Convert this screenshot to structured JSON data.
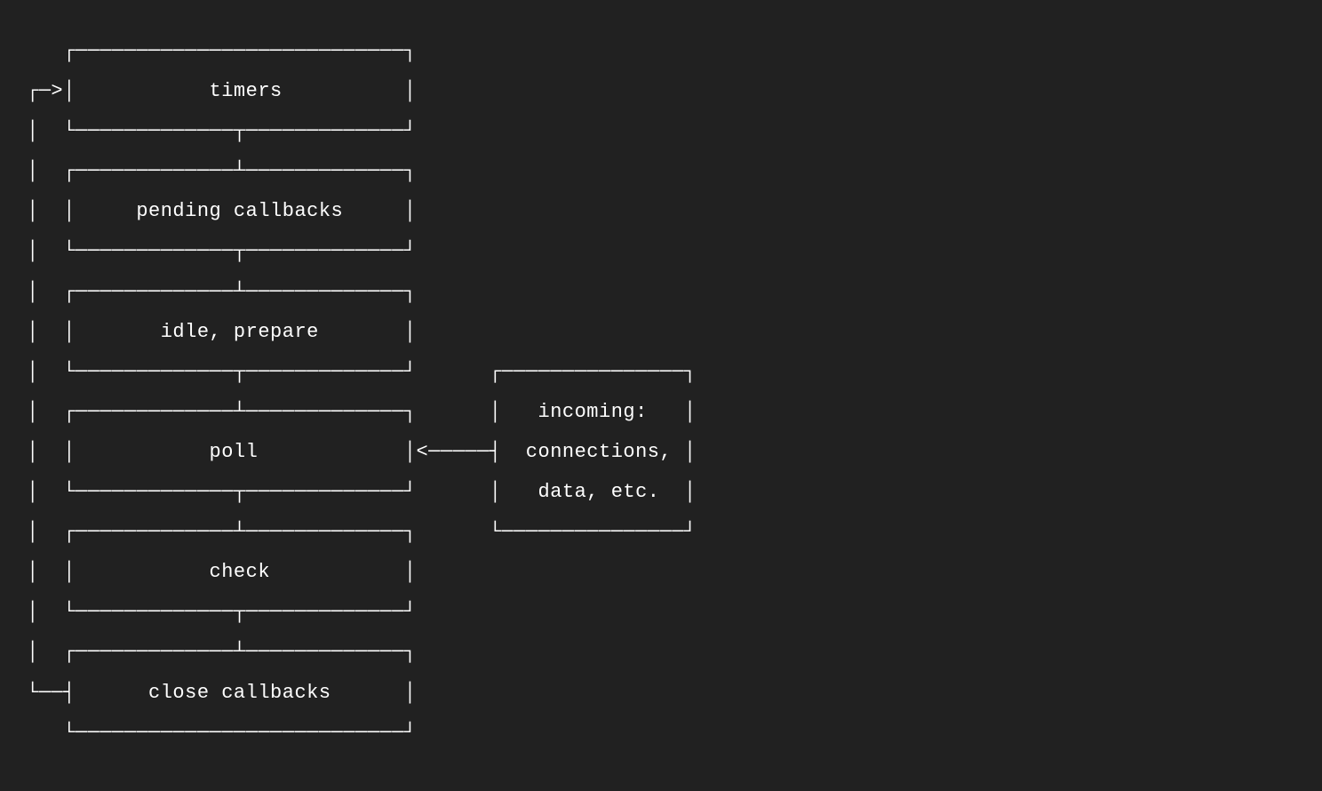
{
  "diagram": {
    "phases": [
      "timers",
      "pending callbacks",
      "idle, prepare",
      "poll",
      "check",
      "close callbacks"
    ],
    "side_box": {
      "line1": "incoming:",
      "line2": "connections,",
      "line3": "data, etc."
    }
  },
  "ascii": {
    "l00": "   ┌───────────────────────────┐",
    "l01": "┌─>│           timers          │",
    "l02": "│  └─────────────┬─────────────┘",
    "l03": "│  ┌─────────────┴─────────────┐",
    "l04": "│  │     pending callbacks     │",
    "l05": "│  └─────────────┬─────────────┘",
    "l06": "│  ┌─────────────┴─────────────┐",
    "l07": "│  │       idle, prepare       │",
    "l08": "│  └─────────────┬─────────────┘      ┌───────────────┐",
    "l09": "│  ┌─────────────┴─────────────┐      │   incoming:   │",
    "l10": "│  │           poll            │<─────┤  connections, │",
    "l11": "│  └─────────────┬─────────────┘      │   data, etc.  │",
    "l12": "│  ┌─────────────┴─────────────┐      └───────────────┘",
    "l13": "│  │           check           │",
    "l14": "│  └─────────────┬─────────────┘",
    "l15": "│  ┌─────────────┴─────────────┐",
    "l16": "└──┤      close callbacks      │",
    "l17": "   └───────────────────────────┘"
  }
}
